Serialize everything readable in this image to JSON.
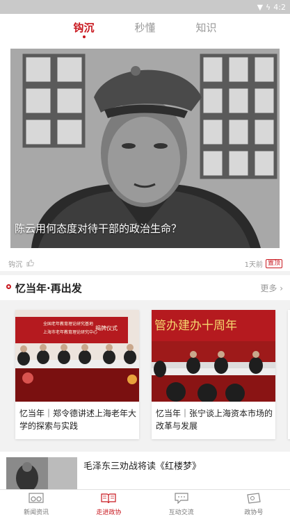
{
  "statusbar": {
    "time": "4:2"
  },
  "tabs": [
    {
      "label": "钩沉",
      "active": true
    },
    {
      "label": "秒懂",
      "active": false
    },
    {
      "label": "知识",
      "active": false
    }
  ],
  "hero": {
    "title": "陈云用何态度对待干部的政治生命？",
    "source": "钩沉",
    "time": "1天前",
    "badge": "置顶"
  },
  "section": {
    "title": "忆当年·再出发",
    "more": "更多",
    "cards": [
      {
        "title": "忆当年｜郑令德讲述上海老年大学的探索与实践",
        "banner_line1": "全国老年教育理论研究基地",
        "banner_line2": "上海市老年教育理论研究中心",
        "banner_tag": "揭牌仪式"
      },
      {
        "title": "忆当年｜张宁谈上海资本市场的改革与发展",
        "banner_line1": "管办建办十周年"
      }
    ]
  },
  "news": {
    "title": "毛泽东三劝战将读《红楼梦》"
  },
  "bottom_nav": [
    {
      "label": "新闻资讯",
      "icon": "glasses-icon",
      "active": false
    },
    {
      "label": "走进政协",
      "icon": "book-icon",
      "active": true
    },
    {
      "label": "互动交流",
      "icon": "chat-icon",
      "active": false
    },
    {
      "label": "政协号",
      "icon": "badge-card-icon",
      "active": false
    }
  ],
  "colors": {
    "accent": "#c8161d",
    "banner_red": "#b51a1f"
  }
}
